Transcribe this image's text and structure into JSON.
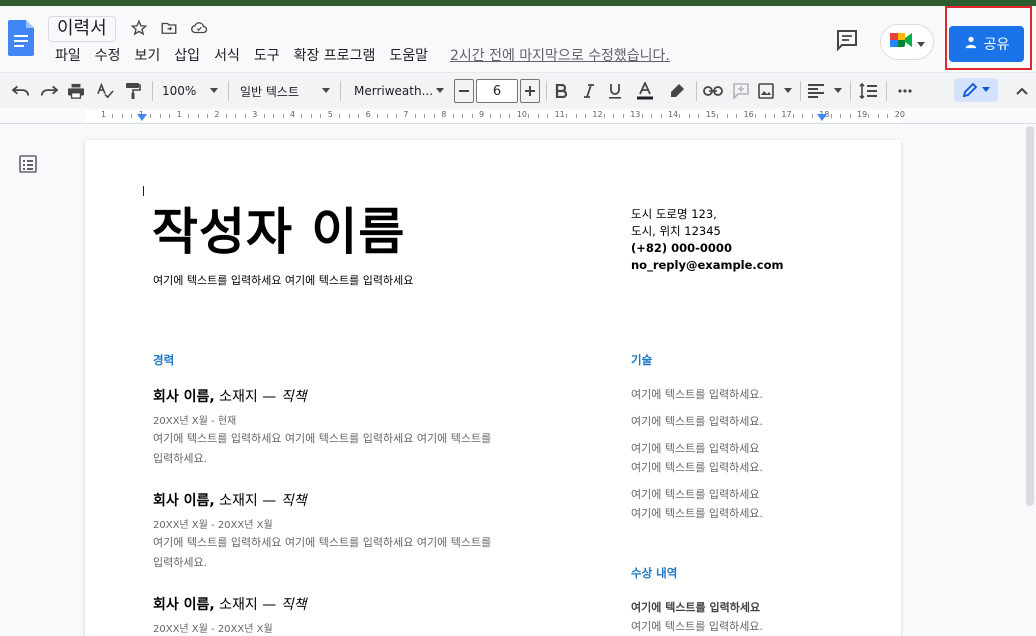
{
  "doc": {
    "title": "이력서",
    "last_edit": "2시간 전에 마지막으로 수정했습니다."
  },
  "menu": [
    "파일",
    "수정",
    "보기",
    "삽입",
    "서식",
    "도구",
    "확장 프로그램",
    "도움말"
  ],
  "share": {
    "label": "공유"
  },
  "toolbar": {
    "zoom": "100%",
    "style": "일반 텍스트",
    "font": "Merriweath...",
    "font_size": "6"
  },
  "ruler": {
    "labels": [
      "1",
      "1",
      "1",
      "2",
      "3",
      "4",
      "5",
      "6",
      "7",
      "8",
      "9",
      "10",
      "11",
      "12",
      "13",
      "14",
      "15",
      "16",
      "17",
      "18",
      "19",
      "20"
    ]
  },
  "resume": {
    "name": "작성자 이름",
    "subtitle": "여기에 텍스트를 입력하세요 여기에 텍스트를 입력하세요",
    "contact": {
      "line1": "도시 도로명 123,",
      "line2": "도시, 위치 12345",
      "phone": "(+82) 000-0000",
      "email": "no_reply@example.com"
    },
    "experience_heading": "경력",
    "jobs": [
      {
        "company": "회사 이름,",
        "location": " 소재지 — ",
        "role": "직책",
        "date": "20XX년 X월 - 현재",
        "desc1": "여기에 텍스트를 입력하세요 여기에 텍스트를 입력하세요 여기에 텍스트를",
        "desc2": "입력하세요."
      },
      {
        "company": "회사 이름,",
        "location": " 소재지 — ",
        "role": "직책",
        "date": "20XX년 X월 - 20XX년 X월",
        "desc1": "여기에 텍스트를 입력하세요 여기에 텍스트를 입력하세요 여기에 텍스트를",
        "desc2": "입력하세요."
      },
      {
        "company": "회사 이름,",
        "location": " 소재지 — ",
        "role": "직책",
        "date": "20XX년 X월 - 20XX년 X월"
      }
    ],
    "skills_heading": "기술",
    "skills": [
      "여기에 텍스트를 입력하세요.",
      "여기에 텍스트를 입력하세요.",
      "여기에 텍스트를 입력하세요",
      "여기에 텍스트를 입력하세요.",
      "여기에 텍스트를 입력하세요",
      "여기에 텍스트를 입력하세요."
    ],
    "awards_heading": "수상 내역",
    "awards": {
      "line1": "여기에 텍스트를 입력하세요",
      "line2": "여기에 텍스트를 입력하세요."
    }
  },
  "colors": {
    "accent": "#1a73e8",
    "section": "#2079c7",
    "highlight": "#e3262d"
  }
}
